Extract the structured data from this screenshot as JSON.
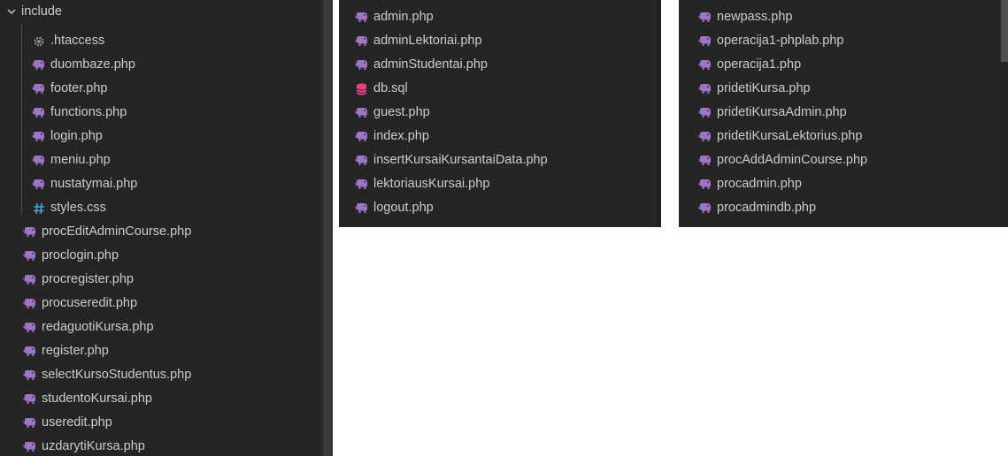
{
  "colors": {
    "php": "#a074c4",
    "db": "#e83e8c",
    "css": "#4aa3df",
    "gear": "#8c8c8c"
  },
  "panel1": {
    "folder": {
      "label": "include",
      "icon": "chevron-down-icon"
    },
    "children": [
      {
        "label": ".htaccess",
        "icon": "gear-icon"
      },
      {
        "label": "duombaze.php",
        "icon": "php-elephant-icon"
      },
      {
        "label": "footer.php",
        "icon": "php-elephant-icon"
      },
      {
        "label": "functions.php",
        "icon": "php-elephant-icon"
      },
      {
        "label": "login.php",
        "icon": "php-elephant-icon"
      },
      {
        "label": "meniu.php",
        "icon": "php-elephant-icon"
      },
      {
        "label": "nustatymai.php",
        "icon": "php-elephant-icon"
      },
      {
        "label": "styles.css",
        "icon": "hash-icon"
      }
    ],
    "files": [
      {
        "label": "procEditAdminCourse.php",
        "icon": "php-elephant-icon"
      },
      {
        "label": "proclogin.php",
        "icon": "php-elephant-icon"
      },
      {
        "label": "procregister.php",
        "icon": "php-elephant-icon"
      },
      {
        "label": "procuseredit.php",
        "icon": "php-elephant-icon"
      },
      {
        "label": "redaguotiKursa.php",
        "icon": "php-elephant-icon"
      },
      {
        "label": "register.php",
        "icon": "php-elephant-icon"
      },
      {
        "label": "selectKursoStudentus.php",
        "icon": "php-elephant-icon"
      },
      {
        "label": "studentoKursai.php",
        "icon": "php-elephant-icon"
      },
      {
        "label": "useredit.php",
        "icon": "php-elephant-icon"
      },
      {
        "label": "uzdarytiKursa.php",
        "icon": "php-elephant-icon"
      }
    ]
  },
  "panel2": {
    "files": [
      {
        "label": "admin.php",
        "icon": "php-elephant-icon"
      },
      {
        "label": "adminLektoriai.php",
        "icon": "php-elephant-icon"
      },
      {
        "label": "adminStudentai.php",
        "icon": "php-elephant-icon"
      },
      {
        "label": "db.sql",
        "icon": "database-icon"
      },
      {
        "label": "guest.php",
        "icon": "php-elephant-icon"
      },
      {
        "label": "index.php",
        "icon": "php-elephant-icon"
      },
      {
        "label": "insertKursaiKursantaiData.php",
        "icon": "php-elephant-icon"
      },
      {
        "label": "lektoriausKursai.php",
        "icon": "php-elephant-icon"
      },
      {
        "label": "logout.php",
        "icon": "php-elephant-icon"
      }
    ]
  },
  "panel3": {
    "files": [
      {
        "label": "newpass.php",
        "icon": "php-elephant-icon"
      },
      {
        "label": "operacija1-phplab.php",
        "icon": "php-elephant-icon"
      },
      {
        "label": "operacija1.php",
        "icon": "php-elephant-icon"
      },
      {
        "label": "pridetiKursa.php",
        "icon": "php-elephant-icon"
      },
      {
        "label": "pridetiKursaAdmin.php",
        "icon": "php-elephant-icon"
      },
      {
        "label": "pridetiKursaLektorius.php",
        "icon": "php-elephant-icon"
      },
      {
        "label": "procAddAdminCourse.php",
        "icon": "php-elephant-icon"
      },
      {
        "label": "procadmin.php",
        "icon": "php-elephant-icon"
      },
      {
        "label": "procadmindb.php",
        "icon": "php-elephant-icon"
      }
    ]
  }
}
